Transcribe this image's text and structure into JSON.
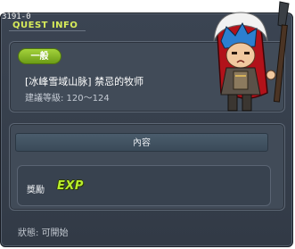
{
  "quest_id": "3191-0",
  "header": {
    "title": "QUEST INFO"
  },
  "quest": {
    "category": "一般",
    "name": "[冰峰雪域山脉] 禁忌的牧师",
    "level_text": "建議等級: 120～124"
  },
  "content": {
    "header": "內容",
    "reward_label": "獎勵",
    "reward_icon": "EXP"
  },
  "status": "狀態: 可開始",
  "colors": {
    "window_bg": "#353e4a",
    "accent_green": "#8fc12a",
    "title_yellow": "#d8ec5a"
  }
}
